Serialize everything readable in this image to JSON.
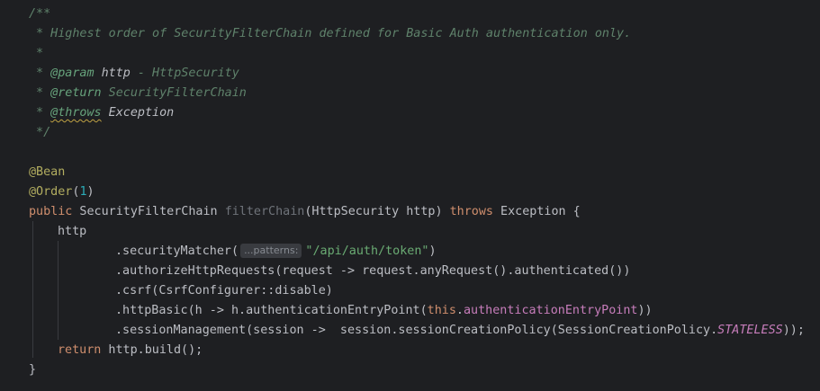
{
  "editor": {
    "lines": {
      "l1": "/**",
      "l2": " * Highest order of SecurityFilterChain defined for Basic Auth authentication only.",
      "l3": " *",
      "l4_prefix": " * ",
      "l4_tag": "@param",
      "l4_name": " http",
      "l4_desc": " - HttpSecurity",
      "l5_prefix": " * ",
      "l5_tag": "@return",
      "l5_desc": " SecurityFilterChain",
      "l6_prefix": " * ",
      "l6_tag": "@throws",
      "l6_desc": " Exception",
      "l7": " */",
      "l9": "@Bean",
      "l10_anno": "@Order",
      "l10_open": "(",
      "l10_num": "1",
      "l10_close": ")",
      "l11_public": "public",
      "l11_type": " SecurityFilterChain ",
      "l11_method": "filterChain",
      "l11_params": "(HttpSecurity http) ",
      "l11_throws": "throws",
      "l11_rest": " Exception {",
      "l12": "http",
      "l13_call": ".securityMatcher(",
      "l13_hint": "...patterns:",
      "l13_str": "\"/api/auth/token\"",
      "l13_close": ")",
      "l14": ".authorizeHttpRequests(request -> request.anyRequest().authenticated())",
      "l15": ".csrf(CsrfConfigurer::disable)",
      "l16_a": ".httpBasic(h -> h.authenticationEntryPoint(",
      "l16_this": "this",
      "l16_dot": ".",
      "l16_field": "authenticationEntryPoint",
      "l16_close": "))",
      "l17_a": ".sessionManagement(session ->  session.sessionCreationPolicy(SessionCreationPolicy.",
      "l17_const": "STATELESS",
      "l17_close": "));",
      "l18_return": "return",
      "l18_rest": " http.build();",
      "l19": "}"
    }
  }
}
